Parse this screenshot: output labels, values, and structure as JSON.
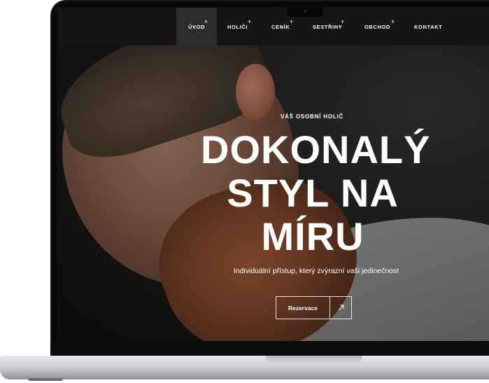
{
  "nav": {
    "items": [
      {
        "label": "ÚVOD",
        "has_submenu": true,
        "active": true
      },
      {
        "label": "HOLIČI",
        "has_submenu": true,
        "active": false
      },
      {
        "label": "CENÍK",
        "has_submenu": true,
        "active": false
      },
      {
        "label": "SESTŘIHY",
        "has_submenu": true,
        "active": false
      },
      {
        "label": "OBCHOD",
        "has_submenu": true,
        "active": false
      },
      {
        "label": "KONTAKT",
        "has_submenu": false,
        "active": false
      }
    ],
    "submenu_symbol": "+"
  },
  "hero": {
    "eyebrow": "VÁŠ OSOBNÍ HOLIČ",
    "title_lines": [
      "DOKONALÝ",
      "STYL NA",
      "MÍRU"
    ],
    "subtitle": "Individuální přístup, který zvýrazní vaši jedinečnost",
    "cta_label": "Rezervace",
    "cta_icon": "arrow-up-right-icon"
  },
  "colors": {
    "nav_bg": "#161413",
    "nav_active_bg": "#2f2d2c",
    "text": "#ffffff"
  }
}
